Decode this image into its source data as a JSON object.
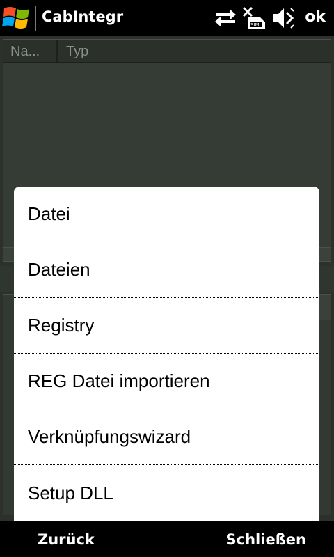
{
  "titlebar": {
    "app_title": "CabIntegr",
    "ok_label": "ok",
    "icons": [
      "windows-start-icon",
      "data-connection-icon",
      "no-sim-icon",
      "volume-muted-icon"
    ]
  },
  "background": {
    "columns": [
      "Na...",
      "Typ"
    ]
  },
  "menu": {
    "items": [
      "Datei",
      "Dateien",
      "Registry",
      "REG Datei importieren",
      "Verknüpfungswizard",
      "Setup DLL"
    ]
  },
  "softkeys": {
    "left": "Zurück",
    "right": "Schließen"
  },
  "colors": {
    "menu_background": "#ffffff",
    "chrome": "#000000",
    "dimmed_background": "#2c312c"
  }
}
